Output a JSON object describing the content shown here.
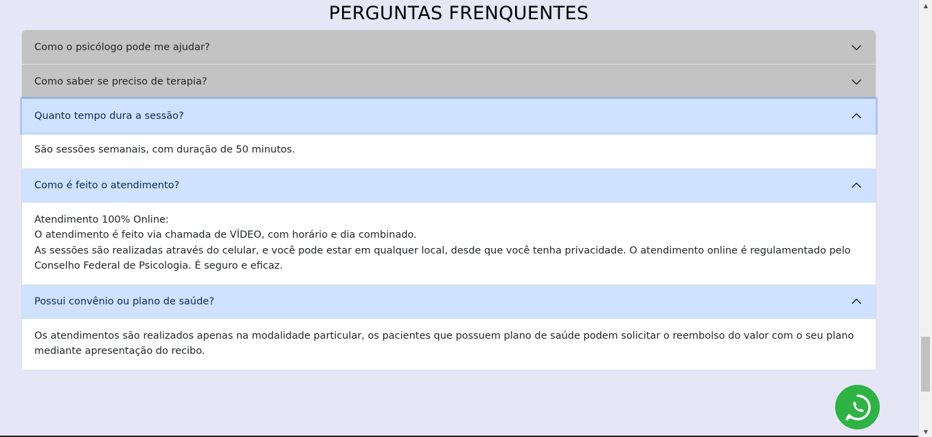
{
  "faq": {
    "title": "PERGUNTAS FRENQUENTES",
    "items": [
      {
        "question": "Como o psicólogo pode me ajudar?",
        "expanded": false
      },
      {
        "question": "Como saber se preciso de terapia?",
        "expanded": false
      },
      {
        "question": "Quanto tempo dura a sessão?",
        "expanded": true,
        "answer": [
          "São sessões semanais, com duração de 50 minutos."
        ]
      },
      {
        "question": "Como é feito o atendimento?",
        "expanded": true,
        "answer": [
          "Atendimento 100% Online:",
          "O atendimento é feito via chamada de VÍDEO, com horário e dia combinado.",
          "As sessões são realizadas através do celular, e você pode estar em qualquer local, desde que você tenha privacidade. O atendimento online é regulamentado pelo Conselho Federal de Psicologia. É seguro e eficaz."
        ]
      },
      {
        "question": "Possui convênio ou plano de saúde?",
        "expanded": true,
        "answer": [
          "Os atendimentos são realizados apenas na modalidade particular, os pacientes que possuem plano de saúde podem solicitar o reembolso do valor com o seu plano mediante apresentação do recibo."
        ]
      }
    ]
  },
  "icons": {
    "collapsed": "chevron-down-icon",
    "expanded": "chevron-up-icon",
    "whatsapp": "whatsapp-icon"
  },
  "colors": {
    "page_bg": "#e6e6f7",
    "collapsed_header": "#c3c3c3",
    "expanded_header": "#cfe2ff",
    "whatsapp": "#2fb344"
  }
}
